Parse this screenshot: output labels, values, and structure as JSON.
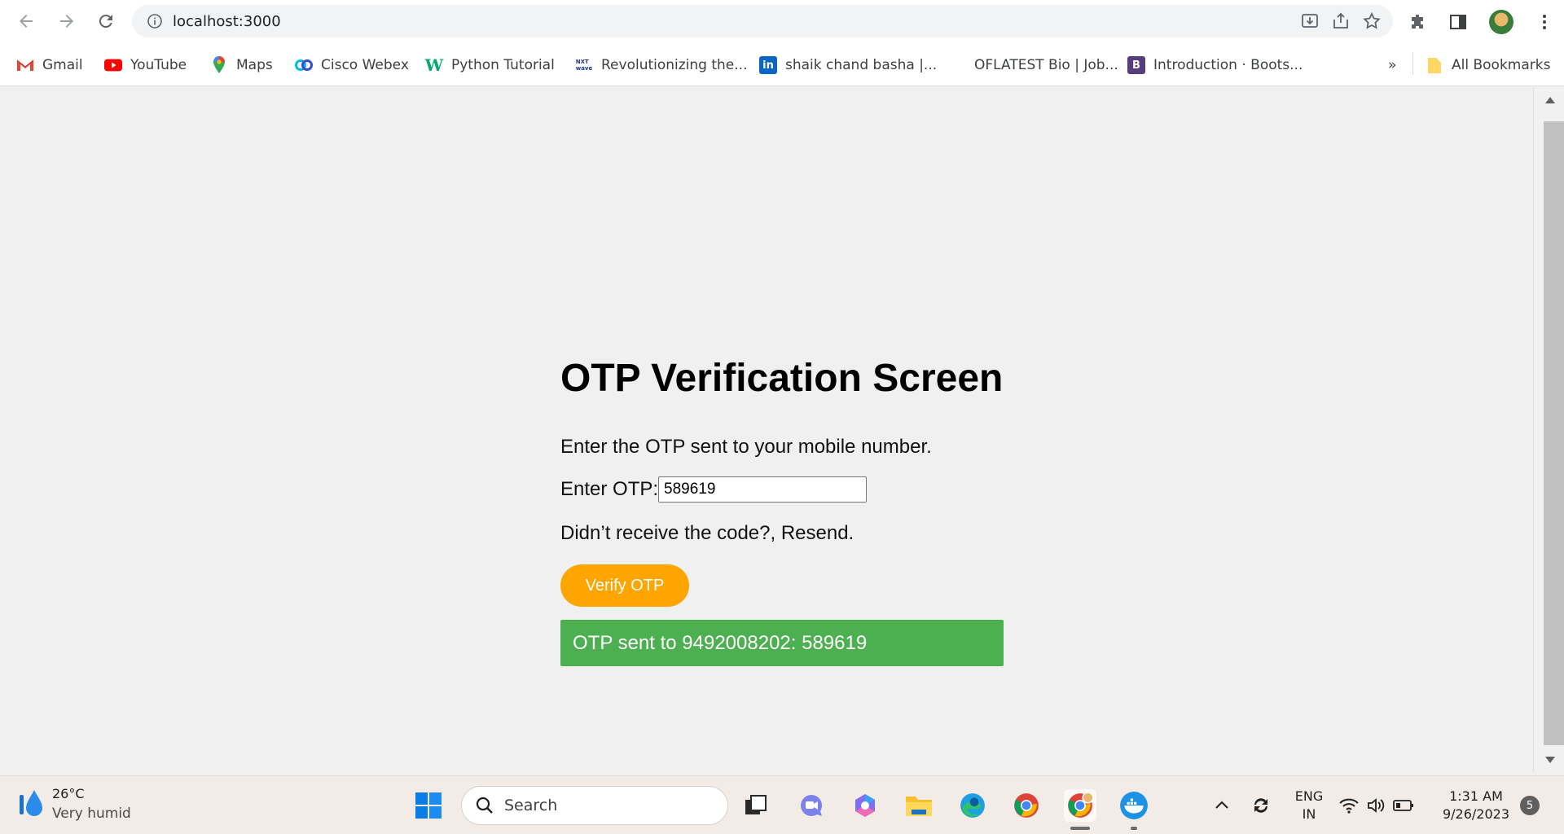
{
  "browser": {
    "url": "localhost:3000",
    "bookmarks": [
      {
        "label": "Gmail",
        "icon": "gmail-icon"
      },
      {
        "label": "YouTube",
        "icon": "youtube-icon"
      },
      {
        "label": "Maps",
        "icon": "maps-icon"
      },
      {
        "label": "Cisco Webex",
        "icon": "webex-icon"
      },
      {
        "label": "Python Tutorial",
        "icon": "w3schools-icon"
      },
      {
        "label": "Revolutionizing the...",
        "icon": "nxtwave-icon"
      },
      {
        "label": "shaik chand basha |...",
        "icon": "linkedin-icon"
      },
      {
        "label": "OFLATEST Bio | Job...",
        "icon": "blank-icon"
      },
      {
        "label": "Introduction · Boots...",
        "icon": "bootstrap-icon"
      }
    ],
    "overflow_label": "»",
    "all_bookmarks_label": "All Bookmarks"
  },
  "page": {
    "title": "OTP Verification Screen",
    "description": "Enter the OTP sent to your mobile number.",
    "otp_label": "Enter OTP:",
    "otp_value": "589619",
    "resend_text": "Didn’t receive the code?, Resend.",
    "verify_button": "Verify OTP",
    "message": "OTP sent to 9492008202: 589619",
    "colors": {
      "button": "#ffa500",
      "message_bg": "#4caf50",
      "background": "#f0f0f0"
    }
  },
  "taskbar": {
    "weather_temp": "26°C",
    "weather_desc": "Very humid",
    "search_placeholder": "Search",
    "language_line1": "ENG",
    "language_line2": "IN",
    "time": "1:31 AM",
    "date": "9/26/2023",
    "notification_count": "5"
  }
}
